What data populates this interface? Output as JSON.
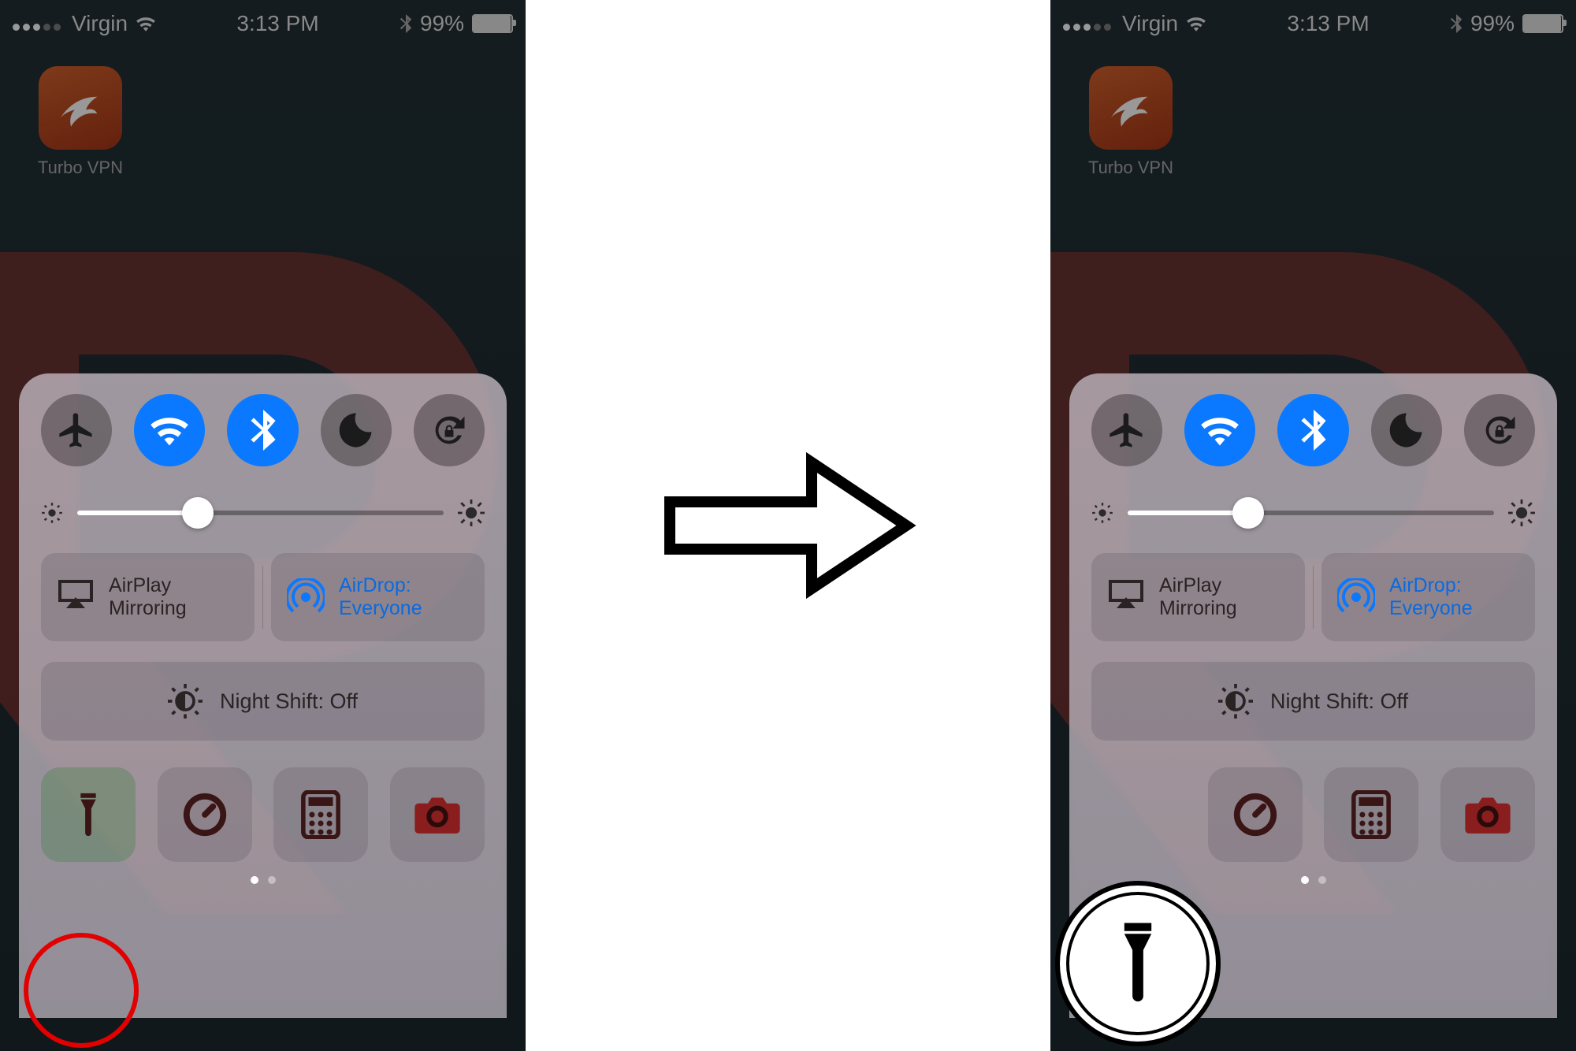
{
  "status": {
    "carrier": "Virgin",
    "time": "3:13 PM",
    "battery_pct": "99%"
  },
  "home": {
    "app_label": "Turbo VPN"
  },
  "cc": {
    "toggles": [
      {
        "name": "airplane-mode",
        "on": false
      },
      {
        "name": "wifi",
        "on": true
      },
      {
        "name": "bluetooth",
        "on": true
      },
      {
        "name": "do-not-disturb",
        "on": false
      },
      {
        "name": "rotation-lock",
        "on": false
      }
    ],
    "brightness_pct": 33,
    "airplay_line1": "AirPlay",
    "airplay_line2": "Mirroring",
    "airdrop_line1": "AirDrop:",
    "airdrop_line2": "Everyone",
    "night_shift": "Night Shift: Off",
    "tools": [
      "flashlight",
      "timer",
      "calculator",
      "camera"
    ]
  },
  "panes": {
    "left": {
      "flashlight_popped": false,
      "red_annotation": true
    },
    "right": {
      "flashlight_popped": true,
      "red_annotation": false
    }
  }
}
